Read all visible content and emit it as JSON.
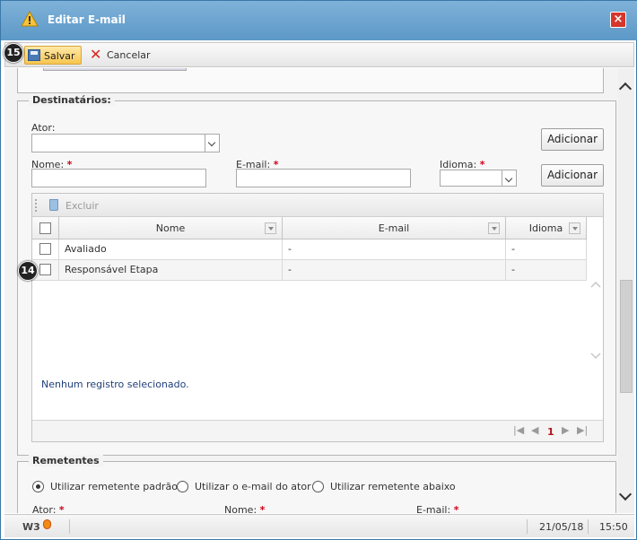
{
  "window": {
    "title": "Editar E-mail",
    "close_label": "×"
  },
  "toolbar": {
    "save_label": "Salvar",
    "cancel_label": "Cancelar",
    "badge_save": "15"
  },
  "recipients": {
    "legend": "Destinatários:",
    "actor_label": "Ator:",
    "actor_value": "",
    "name_label": "Nome:",
    "email_label": "E-mail:",
    "language_label": "Idioma:",
    "required_mark": "*",
    "add_label_1": "Adicionar",
    "add_label_2": "Adicionar",
    "grid": {
      "delete_label": "Excluir",
      "columns": [
        "Nome",
        "E-mail",
        "Idioma"
      ],
      "rows": [
        {
          "name": "Avaliado",
          "email": "-",
          "language": "-"
        },
        {
          "name": "Responsável Etapa",
          "email": "-",
          "language": "-"
        }
      ],
      "row_badge": "14",
      "status": "Nenhum registro selecionado.",
      "page": "1"
    }
  },
  "senders": {
    "legend": "Remetentes",
    "options": [
      "Utilizar remetente padrão",
      "Utilizar o e-mail do ator",
      "Utilizar remetente abaixo"
    ],
    "selected": 0,
    "actor_label": "Ator:",
    "name_label": "Nome:",
    "email_label": "E-mail:"
  },
  "statusbar": {
    "logo": "W3",
    "date": "21/05/18",
    "time": "15:50"
  },
  "colors": {
    "titlebar": "#5c98c7",
    "save_button": "#f7c54f",
    "required": "#d0021b",
    "cancel_icon": "#d7261f"
  }
}
